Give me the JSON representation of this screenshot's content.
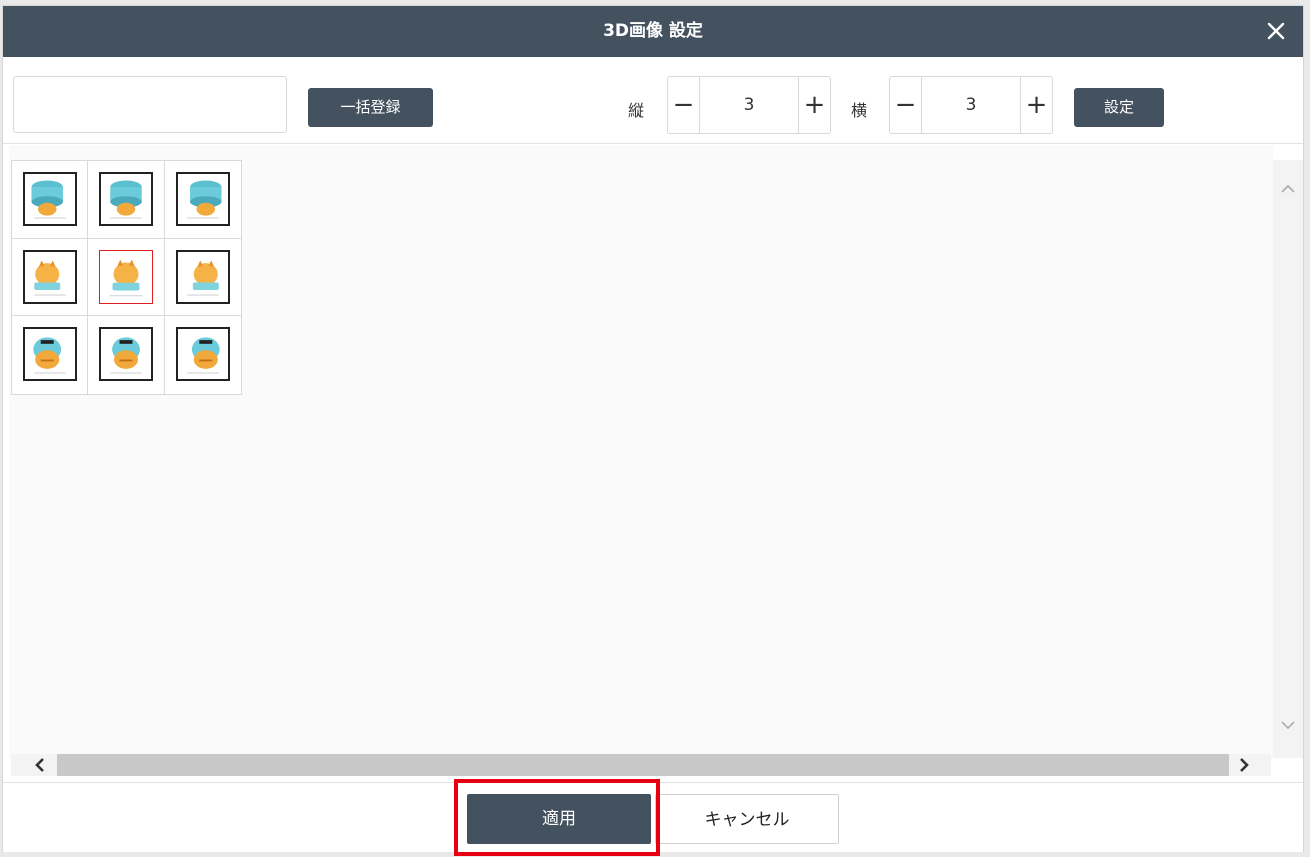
{
  "dialog": {
    "title": "3D画像 設定",
    "close_icon": "close-icon"
  },
  "toolbar": {
    "bulk_input_value": "",
    "bulk_button": "一括登録",
    "rows_label": "縦",
    "rows_value": "3",
    "cols_label": "横",
    "cols_value": "3",
    "minus": "−",
    "plus": "+",
    "set_button": "設定"
  },
  "grid": {
    "rows": 3,
    "cols": 3,
    "selected_index": 4,
    "cells": [
      {
        "view": "top-left"
      },
      {
        "view": "top-center"
      },
      {
        "view": "top-right"
      },
      {
        "view": "middle-left"
      },
      {
        "view": "middle-center"
      },
      {
        "view": "middle-right"
      },
      {
        "view": "bottom-left"
      },
      {
        "view": "bottom-center"
      },
      {
        "view": "bottom-right"
      }
    ]
  },
  "footer": {
    "apply_button": "適用",
    "cancel_button": "キャンセル"
  },
  "colors": {
    "header": "#44525f",
    "highlight": "#e60012",
    "selected_thumb_border": "#e02020"
  }
}
